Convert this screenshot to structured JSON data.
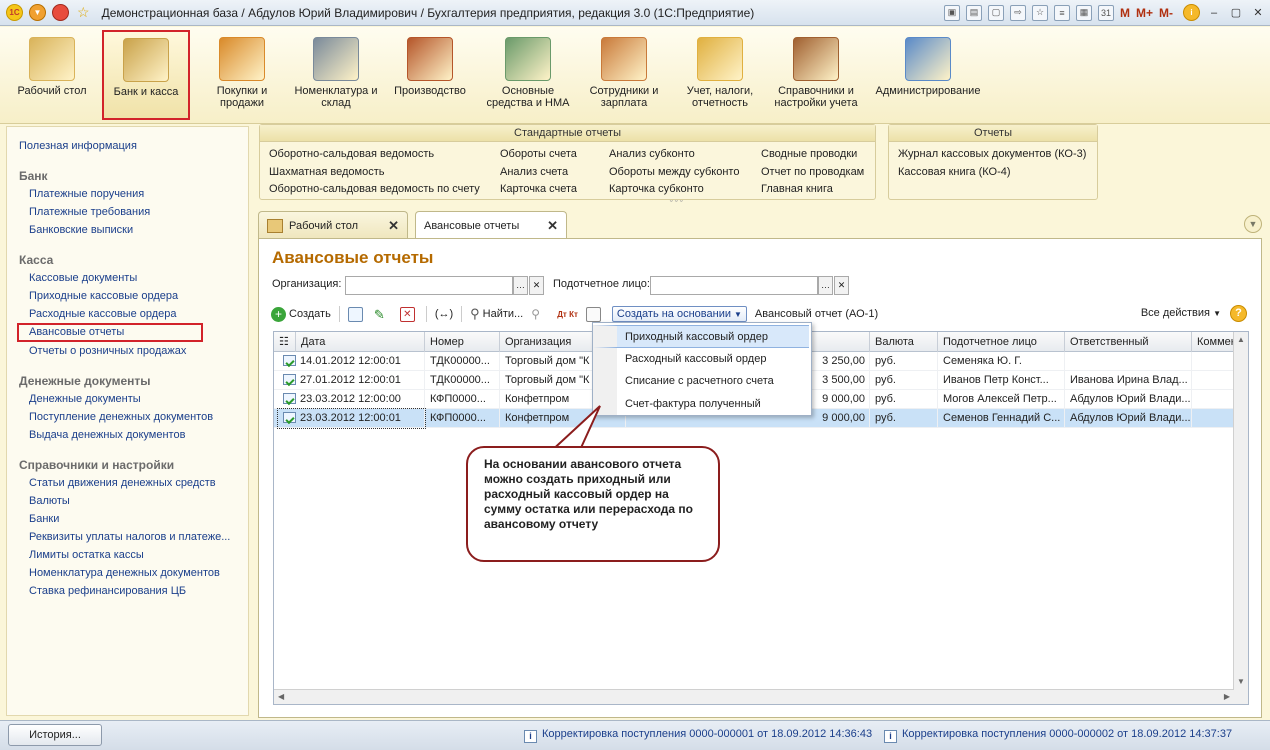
{
  "window": {
    "title": "Демонстрационная база / Абдулов Юрий Владимирович / Бухгалтерия предприятия, редакция 3.0  (1С:Предприятие)",
    "logo": "1С",
    "tools": [
      "M",
      "M+",
      "M-"
    ]
  },
  "sections": [
    {
      "label": "Рабочий стол",
      "icon": "desk-icon"
    },
    {
      "label": "Банк и касса",
      "icon": "coins-icon",
      "active": true
    },
    {
      "label": "Покупки и продажи",
      "icon": "truck-icon"
    },
    {
      "label": "Номенклатура и склад",
      "icon": "warehouse-icon"
    },
    {
      "label": "Производство",
      "icon": "toolbox-icon"
    },
    {
      "label": "Основные средства и НМА",
      "icon": "machine-icon"
    },
    {
      "label": "Сотрудники и зарплата",
      "icon": "employee-icon"
    },
    {
      "label": "Учет, налоги, отчетность",
      "icon": "folder-icon"
    },
    {
      "label": "Справочники и настройки учета",
      "icon": "binders-icon"
    },
    {
      "label": "Администрирование",
      "icon": "computer-icon"
    }
  ],
  "leftnav": {
    "top_link": "Полезная информация",
    "groups": [
      {
        "title": "Банк",
        "items": [
          "Платежные поручения",
          "Платежные требования",
          "Банковские выписки"
        ]
      },
      {
        "title": "Касса",
        "items": [
          "Кассовые документы",
          "Приходные кассовые ордера",
          "Расходные кассовые ордера",
          "Авансовые отчеты",
          "Отчеты о розничных продажах"
        ]
      },
      {
        "title": "Денежные документы",
        "items": [
          "Денежные документы",
          "Поступление денежных документов",
          "Выдача денежных документов"
        ]
      },
      {
        "title": "Справочники и настройки",
        "items": [
          "Статьи движения денежных средств",
          "Валюты",
          "Банки",
          "Реквизиты уплаты налогов и платеже...",
          "Лимиты остатка кассы",
          "Номенклатура денежных документов",
          "Ставка рефинансирования ЦБ"
        ]
      }
    ]
  },
  "reports": {
    "standard_title": "Стандартные отчеты",
    "standard_cols": [
      [
        "Оборотно-сальдовая ведомость",
        "Шахматная ведомость",
        "Оборотно-сальдовая ведомость по счету"
      ],
      [
        "Обороты счета",
        "Анализ счета",
        "Карточка счета"
      ],
      [
        "Анализ субконто",
        "Обороты между субконто",
        "Карточка субконто"
      ],
      [
        "Сводные проводки",
        "Отчет по проводкам",
        "Главная книга"
      ]
    ],
    "other_title": "Отчеты",
    "other_items": [
      "Журнал кассовых документов (КО-3)",
      "Кассовая книга (КО-4)"
    ]
  },
  "tabs": [
    {
      "label": "Рабочий стол"
    },
    {
      "label": "Авансовые отчеты",
      "active": true
    }
  ],
  "main": {
    "title": "Авансовые отчеты",
    "filter_org_label": "Организация:",
    "filter_person_label": "Подотчетное лицо:",
    "filter_org_value": "",
    "filter_person_value": "",
    "toolbar": {
      "create": "Создать",
      "find": "Найти...",
      "create_based": "Создать на основании",
      "report_print": "Авансовый отчет (АО-1)",
      "all_actions": "Все действия"
    }
  },
  "table": {
    "columns": [
      "Дата",
      "Номер",
      "Организация",
      "",
      "",
      "Валюта",
      "Подотчетное лицо",
      "Ответственный",
      "Коммен"
    ],
    "rows": [
      {
        "date": "14.01.2012 12:00:01",
        "number": "ТДК00000...",
        "org": "Торговый дом \"К",
        "amount": "3 250,00",
        "currency": "руб.",
        "person": "Семеняка Ю. Г.",
        "responsible": "",
        "selected": false
      },
      {
        "date": "27.01.2012 12:00:01",
        "number": "ТДК00000...",
        "org": "Торговый дом \"К",
        "amount": "3 500,00",
        "currency": "руб.",
        "person": "Иванов  Петр  Конст...",
        "responsible": "Иванова Ирина Влад...",
        "selected": false
      },
      {
        "date": "23.03.2012 12:00:00",
        "number": "КФП0000...",
        "org": "Конфетпром",
        "amount": "9 000,00",
        "currency": "руб.",
        "person": "Могов Алексей Петр...",
        "responsible": "Абдулов Юрий Влади...",
        "selected": false
      },
      {
        "date": "23.03.2012 12:00:01",
        "number": "КФП0000...",
        "org": "Конфетпром",
        "amount": "9 000,00",
        "currency": "руб.",
        "person": "Семенов Геннадий С...",
        "responsible": "Абдулов Юрий Влади...",
        "selected": true
      }
    ]
  },
  "dropdown": {
    "items": [
      "Приходный кассовый ордер",
      "Расходный кассовый ордер",
      "Списание с расчетного счета",
      "Счет-фактура полученный"
    ],
    "highlighted": 0
  },
  "callout": {
    "text": "На основании авансового отчета можно создать приходный или расходный кассовый ордер на сумму остатка или перерасхода по авансовому отчету"
  },
  "statusbar": {
    "history": "История...",
    "msg1": "Корректировка поступления 0000-000001 от 18.09.2012 14:36:43",
    "msg2": "Корректировка поступления 0000-000002 от 18.09.2012 14:37:37"
  },
  "colors": {
    "accent_red": "#d2232a",
    "link_blue": "#1b3f8b",
    "title_orange": "#b56a00",
    "selection": "#c9e1f7"
  }
}
